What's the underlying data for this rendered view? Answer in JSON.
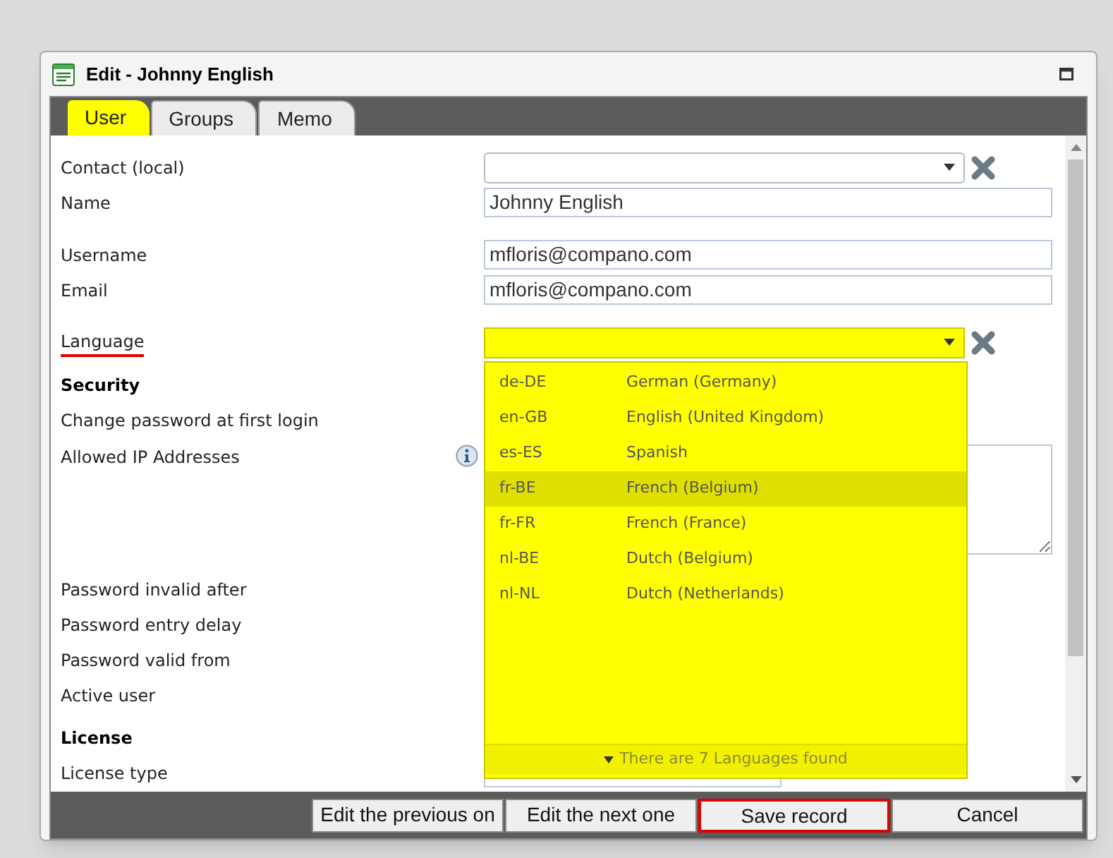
{
  "window": {
    "title": "Edit - Johnny English"
  },
  "tabs": [
    {
      "label": "User",
      "selected": true
    },
    {
      "label": "Groups",
      "selected": false
    },
    {
      "label": "Memo",
      "selected": false
    }
  ],
  "groups": [
    {
      "fields": [
        {
          "label": "Contact (local)",
          "kind": "select",
          "clearable": true
        },
        {
          "label": "Name",
          "kind": "text",
          "value": "Johnny English"
        }
      ]
    },
    {
      "fields": [
        {
          "label": "Username",
          "kind": "text",
          "value": "mfloris@compano.com"
        },
        {
          "label": "Email",
          "kind": "text",
          "value": "mfloris@compano.com"
        }
      ]
    },
    {
      "fields": [
        {
          "label": "Language",
          "kind": "dropdown",
          "clearable": true,
          "annotated": true
        }
      ]
    },
    {
      "heading": "Security",
      "fields": [
        {
          "label": "Change password at first login",
          "kind": "plain"
        },
        {
          "label": "Allowed IP Addresses",
          "kind": "textarea",
          "info": true
        },
        {
          "label": "Password invalid after",
          "kind": "plain"
        },
        {
          "label": "Password entry delay",
          "kind": "plain"
        },
        {
          "label": "Password valid from",
          "kind": "plain"
        },
        {
          "label": "Active user",
          "kind": "plain"
        }
      ]
    },
    {
      "heading": "License",
      "fields": [
        {
          "label": "License type",
          "kind": "short_text"
        }
      ]
    }
  ],
  "language_dropdown": {
    "options": [
      {
        "code": "de-DE",
        "name": "German (Germany)",
        "selected": false
      },
      {
        "code": "en-GB",
        "name": "English (United Kingdom)",
        "selected": false
      },
      {
        "code": "es-ES",
        "name": "Spanish",
        "selected": false
      },
      {
        "code": "fr-BE",
        "name": "French (Belgium)",
        "selected": true
      },
      {
        "code": "fr-FR",
        "name": "French (France)",
        "selected": false
      },
      {
        "code": "nl-BE",
        "name": "Dutch (Belgium)",
        "selected": false
      },
      {
        "code": "nl-NL",
        "name": "Dutch (Netherlands)",
        "selected": false
      }
    ],
    "footer": "There are 7 Languages found"
  },
  "buttons": [
    {
      "label": "Edit the previous on",
      "annotated": false
    },
    {
      "label": "Edit the next one",
      "annotated": false
    },
    {
      "label": "Save record",
      "annotated": true
    },
    {
      "label": "Cancel",
      "annotated": false
    }
  ]
}
